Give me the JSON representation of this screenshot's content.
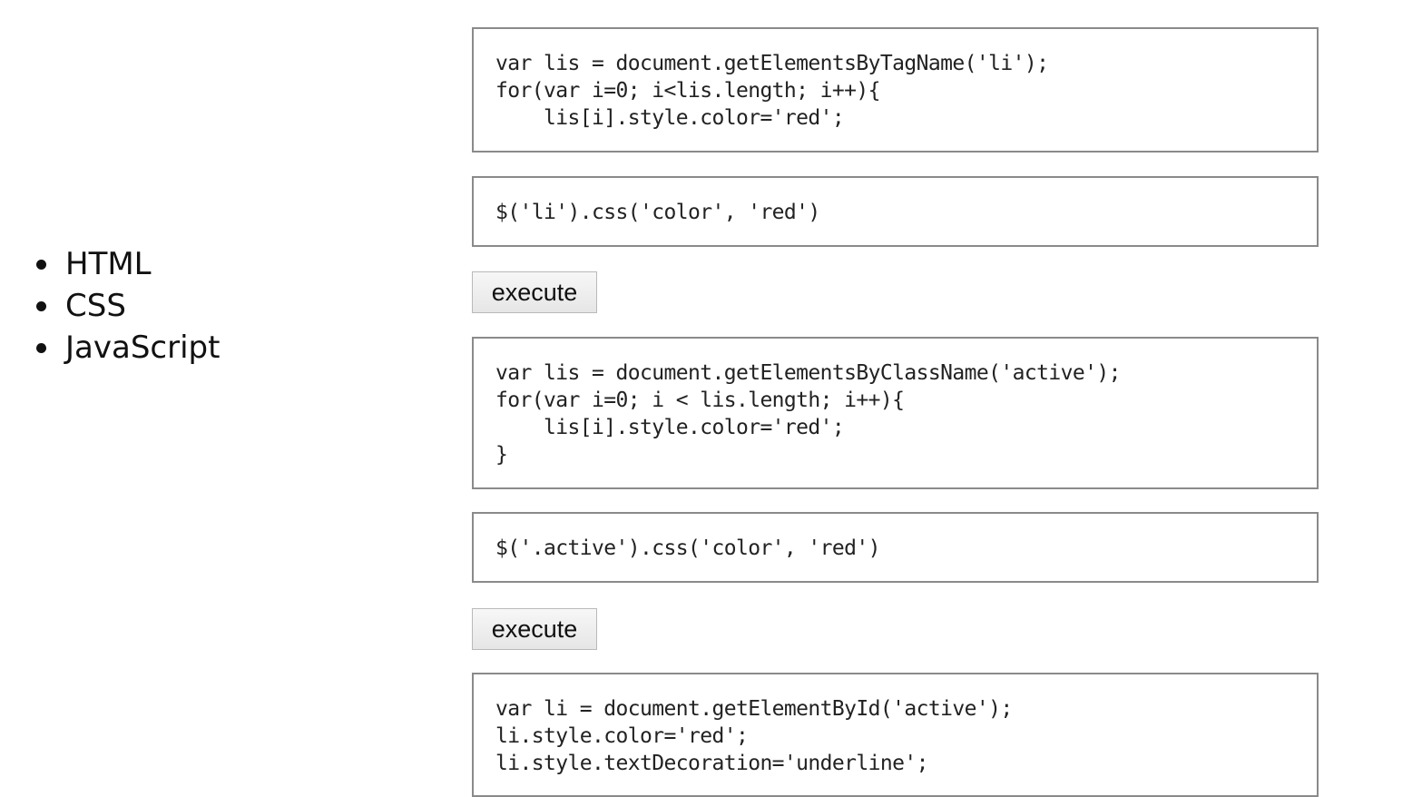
{
  "list": {
    "items": [
      "HTML",
      "CSS",
      "JavaScript"
    ]
  },
  "snippets": {
    "tag_js": "var lis = document.getElementsByTagName('li');\nfor(var i=0; i<lis.length; i++){\n    lis[i].style.color='red';",
    "tag_jquery": "$('li').css('color', 'red')",
    "class_js": "var lis = document.getElementsByClassName('active');\nfor(var i=0; i < lis.length; i++){\n    lis[i].style.color='red';\n}",
    "class_jquery": "$('.active').css('color', 'red')",
    "id_js": "var li = document.getElementById('active');\nli.style.color='red';\nli.style.textDecoration='underline';"
  },
  "buttons": {
    "execute_1": "execute",
    "execute_2": "execute"
  }
}
